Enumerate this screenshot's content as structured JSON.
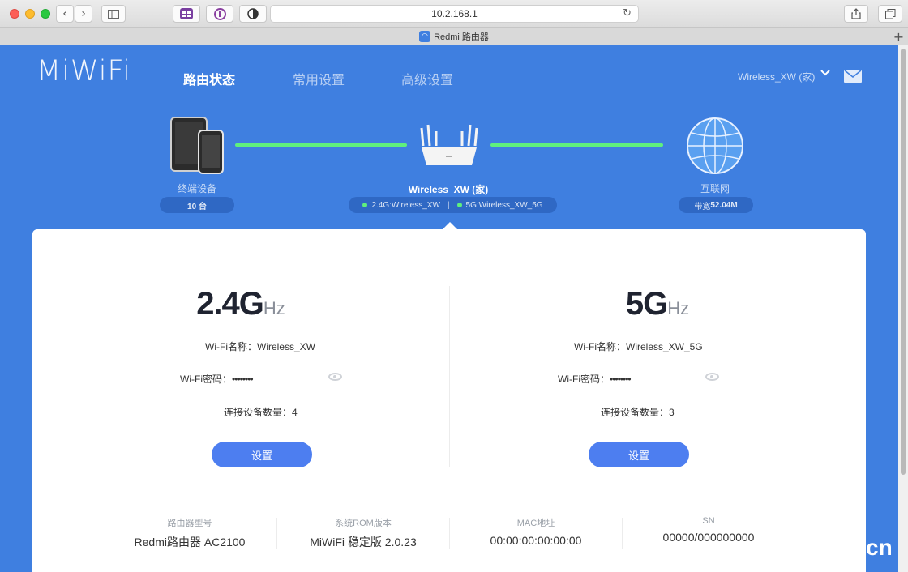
{
  "browser": {
    "url": "10.2.168.1",
    "tab_title": "Redmi 路由器"
  },
  "header": {
    "logo": "MiWiFi",
    "nav": [
      "路由状态",
      "常用设置",
      "高级设置"
    ],
    "account": "Wireless_XW (家)"
  },
  "topology": {
    "devices": {
      "label": "终端设备",
      "count": "10 台"
    },
    "router": {
      "name": "Wireless_XW (家)",
      "ssid_24": "2.4G:Wireless_XW",
      "ssid_5": "5G:Wireless_XW_5G",
      "sep": "|"
    },
    "internet": {
      "label": "互联网",
      "bandwidth_label": "带宽",
      "bandwidth": "52.04M"
    }
  },
  "bands": [
    {
      "big": "2.4G",
      "unit": "Hz",
      "name_label": "Wi-Fi名称：",
      "name": "Wireless_XW",
      "pwd_label": "Wi-Fi密码：",
      "pwd": "••••••••",
      "count_label": "连接设备数量：",
      "count": "4",
      "button": "设置"
    },
    {
      "big": "5G",
      "unit": "Hz",
      "name_label": "Wi-Fi名称：",
      "name": "Wireless_XW_5G",
      "pwd_label": "Wi-Fi密码：",
      "pwd": "••••••••",
      "count_label": "连接设备数量：",
      "count": "3",
      "button": "设置"
    }
  ],
  "info": [
    {
      "label": "路由器型号",
      "value": "Redmi路由器 AC2100"
    },
    {
      "label": "系统ROM版本",
      "value": "MiWiFi 稳定版 2.0.23"
    },
    {
      "label": "MAC地址",
      "value": "00:00:00:00:00:00"
    },
    {
      "label": "SN",
      "value": "00000/000000000"
    }
  ],
  "watermark": "cn"
}
